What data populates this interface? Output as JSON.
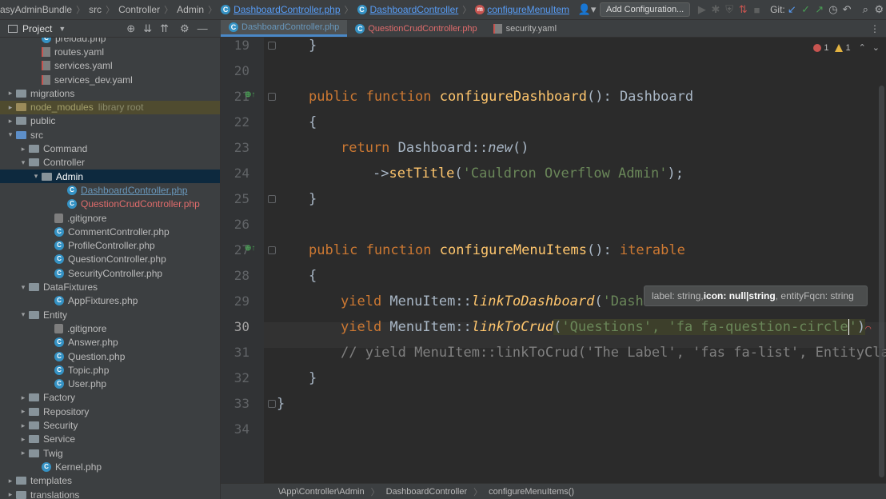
{
  "navbar": {
    "crumbs": [
      "asyAdminBundle",
      "src",
      "Controller",
      "Admin",
      "DashboardController.php",
      "DashboardController",
      "configureMenuItem"
    ],
    "add_config": "Add Configuration...",
    "git_label": "Git:"
  },
  "project": {
    "title": "Project",
    "rows": [
      {
        "label": "preload.php",
        "type": "php-file",
        "indent": 3
      },
      {
        "label": "routes.yaml",
        "type": "yaml",
        "indent": 3
      },
      {
        "label": "services.yaml",
        "type": "yaml",
        "indent": 3
      },
      {
        "label": "services_dev.yaml",
        "type": "yaml",
        "indent": 3
      },
      {
        "label": "migrations",
        "type": "folder",
        "indent": 1
      },
      {
        "label": "node_modules",
        "type": "folder-orange",
        "indent": 1,
        "extra": "library root"
      },
      {
        "label": "public",
        "type": "folder",
        "indent": 1
      },
      {
        "label": "src",
        "type": "folder-blue",
        "indent": 1,
        "open": true
      },
      {
        "label": "Command",
        "type": "folder",
        "indent": 2
      },
      {
        "label": "Controller",
        "type": "folder",
        "indent": 2,
        "open": true
      },
      {
        "label": "Admin",
        "type": "folder",
        "indent": 3,
        "open": true,
        "selected": true
      },
      {
        "label": "DashboardController.php",
        "type": "php",
        "indent": 5,
        "color": "blue"
      },
      {
        "label": "QuestionCrudController.php",
        "type": "php",
        "indent": 5,
        "color": "red"
      },
      {
        "label": ".gitignore",
        "type": "git",
        "indent": 4
      },
      {
        "label": "CommentController.php",
        "type": "php",
        "indent": 4
      },
      {
        "label": "ProfileController.php",
        "type": "php",
        "indent": 4
      },
      {
        "label": "QuestionController.php",
        "type": "php",
        "indent": 4
      },
      {
        "label": "SecurityController.php",
        "type": "php",
        "indent": 4
      },
      {
        "label": "DataFixtures",
        "type": "folder",
        "indent": 2,
        "open": true
      },
      {
        "label": "AppFixtures.php",
        "type": "php",
        "indent": 4
      },
      {
        "label": "Entity",
        "type": "folder",
        "indent": 2,
        "open": true
      },
      {
        "label": ".gitignore",
        "type": "git",
        "indent": 4
      },
      {
        "label": "Answer.php",
        "type": "php",
        "indent": 4
      },
      {
        "label": "Question.php",
        "type": "php",
        "indent": 4
      },
      {
        "label": "Topic.php",
        "type": "php",
        "indent": 4
      },
      {
        "label": "User.php",
        "type": "php",
        "indent": 4
      },
      {
        "label": "Factory",
        "type": "folder",
        "indent": 2
      },
      {
        "label": "Repository",
        "type": "folder",
        "indent": 2
      },
      {
        "label": "Security",
        "type": "folder",
        "indent": 2
      },
      {
        "label": "Service",
        "type": "folder",
        "indent": 2
      },
      {
        "label": "Twig",
        "type": "folder",
        "indent": 2
      },
      {
        "label": "Kernel.php",
        "type": "php",
        "indent": 3
      },
      {
        "label": "templates",
        "type": "folder",
        "indent": 1
      },
      {
        "label": "translations",
        "type": "folder",
        "indent": 1
      }
    ]
  },
  "tabs": [
    {
      "label": "DashboardController.php",
      "active": true,
      "color": "blue"
    },
    {
      "label": "QuestionCrudController.php",
      "active": false,
      "color": "red"
    },
    {
      "label": "security.yaml",
      "active": false,
      "color": "plain"
    }
  ],
  "inspection": {
    "errors": "1",
    "warnings": "1"
  },
  "editor": {
    "line_numbers": [
      "19",
      "20",
      "21",
      "22",
      "23",
      "24",
      "25",
      "26",
      "27",
      "28",
      "29",
      "30",
      "31",
      "32",
      "33",
      "34"
    ],
    "current_line": "30",
    "lines": {
      "l19": "}",
      "l21_kw": "public function ",
      "l21_fn": "configureDashboard",
      "l21_rest": "(): Dashboard",
      "l22": "{",
      "l23_kw": "return ",
      "l23_cls": "Dashboard::",
      "l23_new": "new",
      "l23_rest": "()",
      "l24_arrow": "->",
      "l24_fn": "setTitle",
      "l24_p1": "(",
      "l24_str": "'Cauldron Overflow Admin'",
      "l24_p2": ");",
      "l25": "}",
      "l27_kw": "public function ",
      "l27_fn": "configureMenuItems",
      "l27_rest": "(): ",
      "l27_ret": "iterable",
      "l28": "{",
      "l29_kw": "yield ",
      "l29_cls": "MenuItem::",
      "l29_fn": "linkToDashboard",
      "l29_p": "(",
      "l29_str": "'Dashb",
      "l30_kw": "yield ",
      "l30_cls": "MenuItem::",
      "l30_fn": "linkToCrud",
      "l30_p1": "(",
      "l30_str1": "'Questions'",
      "l30_comma": ", ",
      "l30_str2": "'fa fa-question-circle",
      "l30_str2_end": "'",
      "l30_p2": ")",
      "l31": "// yield MenuItem::linkToCrud('The Label', 'fas fa-list', EntityClass",
      "l32": "}",
      "l33": "}"
    }
  },
  "tooltip": {
    "part1": "label: string, ",
    "part2": "icon: null|string",
    "part3": ", entityFqcn: string"
  },
  "breadcrumb": [
    "\\App\\Controller\\Admin",
    "DashboardController",
    "configureMenuItems()"
  ]
}
